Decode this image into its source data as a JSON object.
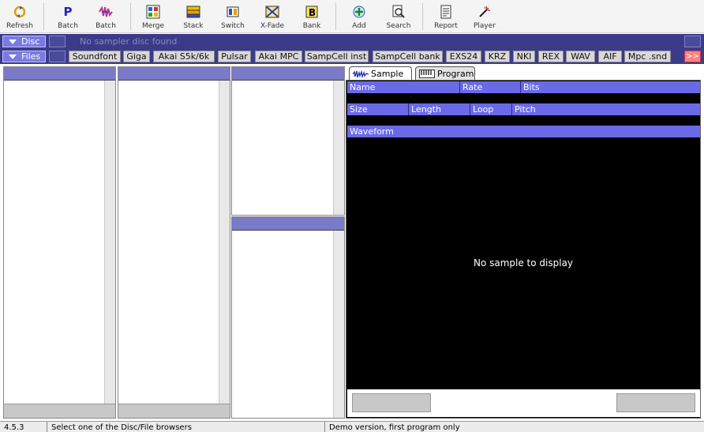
{
  "toolbar": {
    "items": [
      {
        "label": "Refresh",
        "icon": "refresh-icon"
      },
      {
        "label": "Batch",
        "icon": "batch-p-icon"
      },
      {
        "label": "Batch",
        "icon": "batch-wave-icon"
      },
      {
        "label": "Merge",
        "icon": "merge-icon"
      },
      {
        "label": "Stack",
        "icon": "stack-icon"
      },
      {
        "label": "Switch",
        "icon": "switch-icon"
      },
      {
        "label": "X-Fade",
        "icon": "xfade-icon"
      },
      {
        "label": "Bank",
        "icon": "bank-icon"
      },
      {
        "label": "Add",
        "icon": "add-icon"
      },
      {
        "label": "Search",
        "icon": "search-icon"
      },
      {
        "label": "Report",
        "icon": "report-icon"
      },
      {
        "label": "Player",
        "icon": "player-icon"
      }
    ]
  },
  "disc_bar": {
    "label": "Disc",
    "message": "No sampler disc found"
  },
  "files_bar": {
    "label": "Files",
    "types": [
      "Soundfont",
      "Giga",
      "Akai S5k/6k",
      "Pulsar",
      "Akai MPC",
      "SampCell inst",
      "SampCell bank",
      "EXS24",
      "KRZ",
      "NKI",
      "REX",
      "WAV",
      "AIF",
      "Mpc .snd"
    ],
    "more_label": ">>"
  },
  "tabs": {
    "sample": "Sample",
    "program": "Program"
  },
  "sample_panel": {
    "row1": [
      "Name",
      "Rate",
      "Bits"
    ],
    "row2": [
      "Size",
      "Length",
      "Loop",
      "Pitch"
    ],
    "waveform_label": "Waveform",
    "empty_message": "No sample to display"
  },
  "status": {
    "version": "4.5.3",
    "hint": "Select one of the Disc/File browsers",
    "notice": "Demo version, first program only"
  },
  "colors": {
    "bar_bg": "#3b3b8a",
    "header_blue": "#6a6ae8",
    "more_button": "#ff8080"
  }
}
